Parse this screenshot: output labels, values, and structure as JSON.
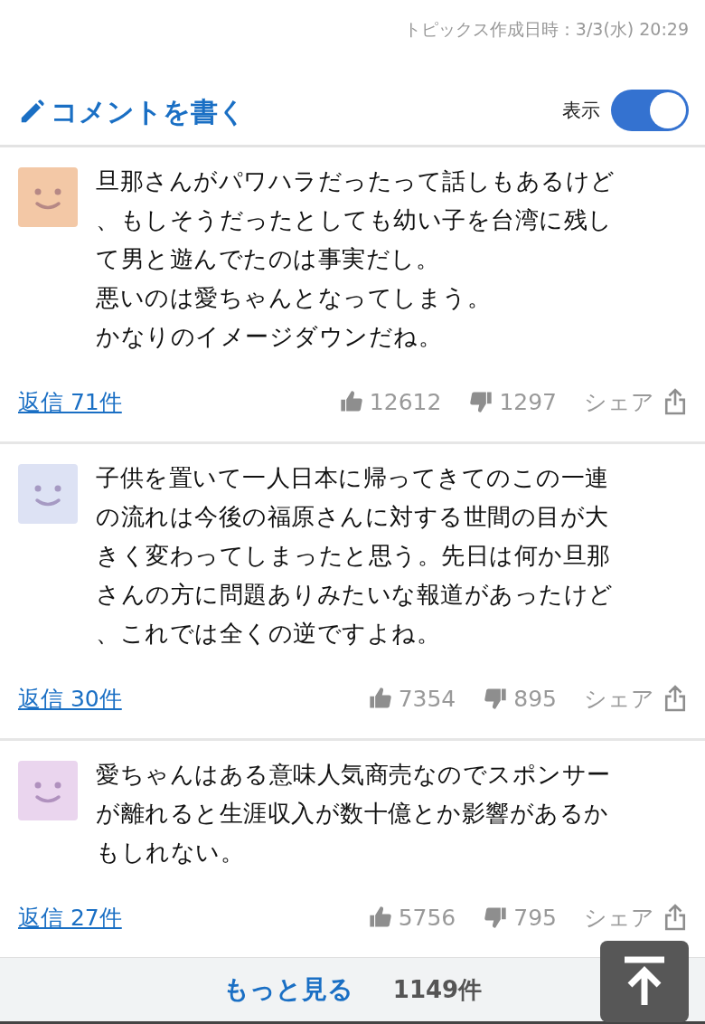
{
  "topic_date": "トピックス作成日時：3/3(水) 20:29",
  "header": {
    "write_comment": "コメントを書く",
    "display_label": "表示",
    "display_on": true
  },
  "comments": [
    {
      "body": [
        "旦那さんがパワハラだったって話しもあるけど、もしそうだったとしても幼い子を台湾に残して男と遊んでたのは事実だし。",
        "悪いのは愛ちゃんとなってしまう。",
        "かなりのイメージダウンだね。"
      ],
      "replies": "返信 71件",
      "likes": "12612",
      "dislikes": "1297",
      "share": "シェア"
    },
    {
      "body": [
        "子供を置いて一人日本に帰ってきてのこの一連の流れは今後の福原さんに対する世間の目が大きく変わってしまったと思う。先日は何か旦那さんの方に問題ありみたいな報道があったけど、これでは全くの逆ですよね。"
      ],
      "replies": "返信 30件",
      "likes": "7354",
      "dislikes": "895",
      "share": "シェア"
    },
    {
      "body": [
        "愛ちゃんはある意味人気商売なのでスポンサーが離れると生涯収入が数十億とか影響があるかもしれない。"
      ],
      "replies": "返信 27件",
      "likes": "5756",
      "dislikes": "795",
      "share": "シェア"
    }
  ],
  "more": {
    "label": "もっと見る",
    "count": "1149件"
  }
}
